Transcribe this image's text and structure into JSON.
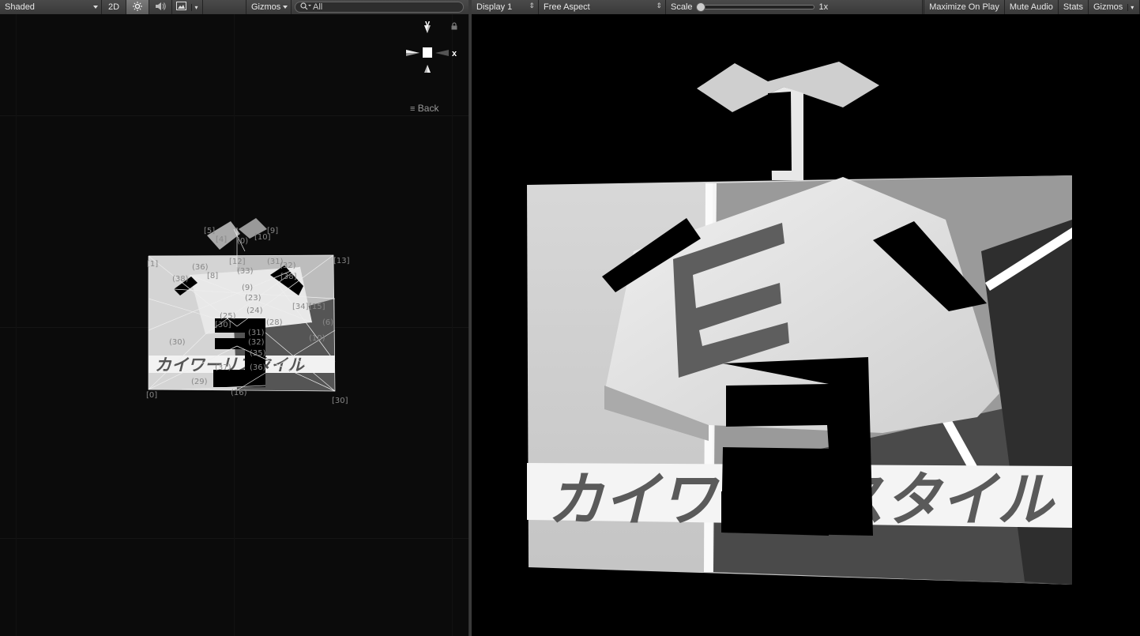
{
  "scene_toolbar": {
    "draw_mode": "Shaded",
    "mode_2d": "2D",
    "lighting_icon": "sun-icon",
    "audio_icon": "speaker-icon",
    "effects_icon": "image-icon",
    "gizmos": "Gizmos",
    "search_placeholder": "All"
  },
  "game_toolbar": {
    "display": "Display 1",
    "aspect": "Free Aspect",
    "scale_label": "Scale",
    "scale_value": "1x",
    "maximize": "Maximize On Play",
    "mute": "Mute Audio",
    "stats": "Stats",
    "gizmos": "Gizmos"
  },
  "scene_view": {
    "axis_y": "y",
    "axis_x": "x",
    "view_label": "Back",
    "vertex_labels": [
      "[5]",
      "[9]",
      "[4]",
      "(0)",
      "[10]",
      "[12]",
      "(31)",
      "[1]",
      "[13]",
      "(36)",
      "(38)",
      "[8]",
      "(32)",
      "(9)",
      "(33)",
      "[38]",
      "(23)",
      "(24)",
      "[34]",
      "[15]",
      "(25)",
      "[30]",
      "(28)",
      "(6)",
      "(30)",
      "(10)",
      "(31)",
      "(32)",
      "(35)",
      "(37)",
      "(36)",
      "(29)",
      "[0]",
      "(16)",
      "[30]"
    ],
    "logo_text": "カイワーリスタイル"
  },
  "game_view": {
    "logo_text": "カイワーリスタイル"
  },
  "colors": {
    "toolbar": "#3f3f3f",
    "scene_bg": "#0b0b0b",
    "game_bg": "#000000"
  }
}
